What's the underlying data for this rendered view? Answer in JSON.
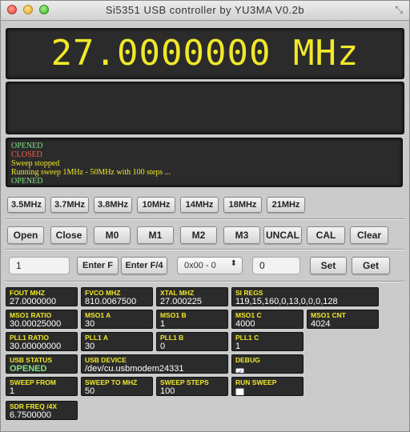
{
  "window": {
    "title": "Si5351 USB controller by YU3MA V0.2b"
  },
  "display": {
    "frequency": "27.0000000 MHz"
  },
  "log": [
    {
      "text": "OPENED",
      "color": "#7fe07f"
    },
    {
      "text": "CLOSED",
      "color": "#ff5a4a"
    },
    {
      "text": "Sweep stopped",
      "color": "#f0e82a"
    },
    {
      "text": "Running sweep 1MHz - 50MHz with 100 steps ...",
      "color": "#f0e82a"
    },
    {
      "text": "OPENED",
      "color": "#7fe07f"
    }
  ],
  "presets": [
    "3.5MHz",
    "3.7MHz",
    "3.8MHz",
    "10MHz",
    "14MHz",
    "18MHz",
    "21MHz"
  ],
  "controls": [
    "Open",
    "Close",
    "M0",
    "M1",
    "M2",
    "M3",
    "UNCAL",
    "CAL",
    "Clear"
  ],
  "entry": {
    "freq_value": "1",
    "enter_f": "Enter F",
    "enter_f4": "Enter F/4",
    "register_select": "0x00 - 0",
    "reg_value": "0",
    "set": "Set",
    "get": "Get"
  },
  "cells": {
    "fout": {
      "label": "FOUT MHZ",
      "value": "27.0000000"
    },
    "fvco": {
      "label": "FVCO MHZ",
      "value": "810.0067500"
    },
    "xtal": {
      "label": "XTAL MHZ",
      "value": "27.000225"
    },
    "siregs": {
      "label": "SI REGS",
      "value": "119,15,160,0,13,0,0,0,128"
    },
    "ms01_ratio": {
      "label": "MSO1 RATIO",
      "value": "30.00025000"
    },
    "ms01_a": {
      "label": "MSO1 A",
      "value": "30"
    },
    "ms01_b": {
      "label": "MSO1 B",
      "value": "1"
    },
    "ms01_c": {
      "label": "MSO1 C",
      "value": "4000"
    },
    "ms01_cnt": {
      "label": "MSO1 CNT",
      "value": "4024"
    },
    "pll1_ratio": {
      "label": "PLL1 RATIO",
      "value": "30.00000000"
    },
    "pll1_a": {
      "label": "PLL1 A",
      "value": "30"
    },
    "pll1_b": {
      "label": "PLL1 B",
      "value": "0"
    },
    "pll1_c": {
      "label": "PLL1 C",
      "value": "1"
    },
    "usb_status": {
      "label": "USB STATUS",
      "value": "OPENED"
    },
    "usb_device": {
      "label": "USB DEVICE",
      "value": "/dev/cu.usbmodem24331"
    },
    "debug": {
      "label": "DEBUG",
      "checked": true
    },
    "sweep_from": {
      "label": "SWEEP FROM",
      "value": "1"
    },
    "sweep_to": {
      "label": "SWEEP TO MHZ",
      "value": "50"
    },
    "sweep_steps": {
      "label": "SWEEP STEPS",
      "value": "100"
    },
    "run_sweep": {
      "label": "RUN SWEEP",
      "checked": false
    },
    "sdr_freq": {
      "label": "SDR FREQ /4X",
      "value": "6.7500000"
    }
  }
}
